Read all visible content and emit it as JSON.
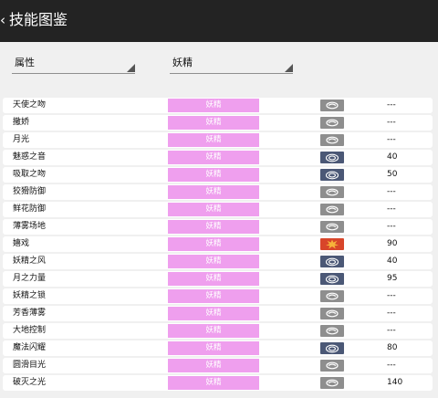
{
  "app": {
    "back_symbol": "‹",
    "title": "技能图鉴"
  },
  "filters": {
    "attribute_label": "属性",
    "type_value": "妖精"
  },
  "category_colors": {
    "status": "#8e8e8e",
    "special": "#4b5876",
    "physical": "#d8452a"
  },
  "moves": [
    {
      "name": "天使之吻",
      "type": "妖精",
      "category": "status",
      "category_icon": "status-swirl-icon",
      "power": "---"
    },
    {
      "name": "撒娇",
      "type": "妖精",
      "category": "status",
      "category_icon": "status-swirl-icon",
      "power": "---"
    },
    {
      "name": "月光",
      "type": "妖精",
      "category": "status",
      "category_icon": "status-swirl-icon",
      "power": "---"
    },
    {
      "name": "魅惑之音",
      "type": "妖精",
      "category": "special",
      "category_icon": "special-ring-icon",
      "power": "40"
    },
    {
      "name": "吸取之吻",
      "type": "妖精",
      "category": "special",
      "category_icon": "special-ring-icon",
      "power": "50"
    },
    {
      "name": "狡猾防御",
      "type": "妖精",
      "category": "status",
      "category_icon": "status-swirl-icon",
      "power": "---"
    },
    {
      "name": "鲜花防御",
      "type": "妖精",
      "category": "status",
      "category_icon": "status-swirl-icon",
      "power": "---"
    },
    {
      "name": "薄雾场地",
      "type": "妖精",
      "category": "status",
      "category_icon": "status-swirl-icon",
      "power": "---"
    },
    {
      "name": "嬉戏",
      "type": "妖精",
      "category": "physical",
      "category_icon": "physical-burst-icon",
      "power": "90"
    },
    {
      "name": "妖精之风",
      "type": "妖精",
      "category": "special",
      "category_icon": "special-ring-icon",
      "power": "40"
    },
    {
      "name": "月之力量",
      "type": "妖精",
      "category": "special",
      "category_icon": "special-ring-icon",
      "power": "95"
    },
    {
      "name": "妖精之锁",
      "type": "妖精",
      "category": "status",
      "category_icon": "status-swirl-icon",
      "power": "---"
    },
    {
      "name": "芳香薄雾",
      "type": "妖精",
      "category": "status",
      "category_icon": "status-swirl-icon",
      "power": "---"
    },
    {
      "name": "大地控制",
      "type": "妖精",
      "category": "status",
      "category_icon": "status-swirl-icon",
      "power": "---"
    },
    {
      "name": "魔法闪耀",
      "type": "妖精",
      "category": "special",
      "category_icon": "special-ring-icon",
      "power": "80"
    },
    {
      "name": "圆滑目光",
      "type": "妖精",
      "category": "status",
      "category_icon": "status-swirl-icon",
      "power": "---"
    },
    {
      "name": "破灭之光",
      "type": "妖精",
      "category": "status",
      "category_icon": "status-swirl-icon",
      "power": "140"
    }
  ]
}
